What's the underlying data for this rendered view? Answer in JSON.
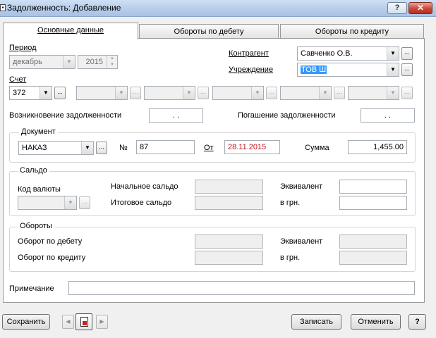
{
  "window": {
    "title": "Задолженность: Добавление",
    "help_label": "?",
    "close_label": "✕"
  },
  "tabs": [
    "Основные данные",
    "Обороты по дебету",
    "Обороты по кредиту"
  ],
  "period": {
    "label": "Период",
    "month": "декабрь",
    "year": "2015"
  },
  "counterparty": {
    "label": "Контрагент",
    "value": "Савченко О.В."
  },
  "institution": {
    "label": "Учреждение",
    "value": "ТОВ Ш"
  },
  "account": {
    "label": "Счет",
    "value": "372"
  },
  "debt": {
    "origin_label": "Возникновение задолженности",
    "origin_value": ". .",
    "repayment_label": "Погашение задолженности",
    "repayment_value": ". ."
  },
  "document": {
    "group_label": "Документ",
    "type": "НАКАЗ",
    "number_label": "№",
    "number": "87",
    "date_label": "От",
    "date": "28.11.2015",
    "amount_label": "Сумма",
    "amount": "1,455.00"
  },
  "saldo": {
    "group_label": "Сальдо",
    "currency_label": "Код валюты",
    "opening_label": "Начальное сальдо",
    "closing_label": "Итоговое сальдо",
    "equivalent_label": "Эквивалент",
    "uah_label": "в грн."
  },
  "turnovers": {
    "group_label": "Обороты",
    "debit_label": "Оборот по дебету",
    "credit_label": "Оборот по кредиту",
    "equivalent_label": "Эквивалент",
    "uah_label": "в грн."
  },
  "note": {
    "label": "Примечание",
    "value": ""
  },
  "footer": {
    "save": "Сохранить",
    "write": "Записать",
    "cancel": "Отменить",
    "help": "?"
  },
  "colors": {
    "date_text": "#c0141a",
    "selection": "#3399ff"
  }
}
